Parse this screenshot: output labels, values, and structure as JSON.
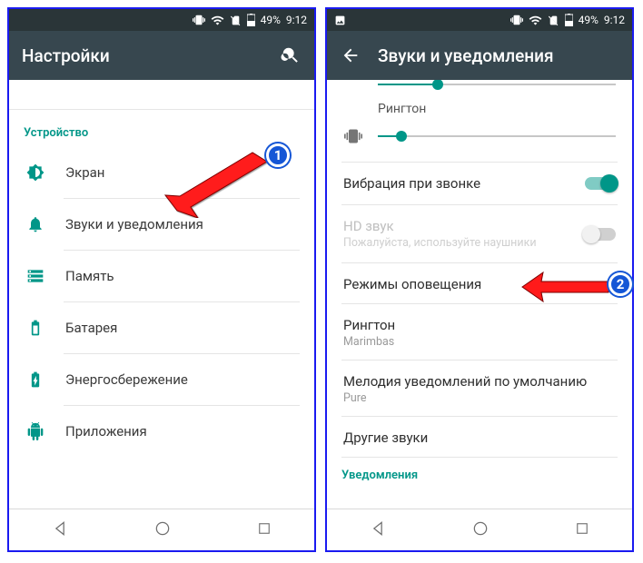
{
  "status": {
    "battery": "49%",
    "time": "9:12"
  },
  "left": {
    "title": "Настройки",
    "section": "Устройство",
    "items": [
      {
        "label": "Экран"
      },
      {
        "label": "Звуки и уведомления"
      },
      {
        "label": "Память"
      },
      {
        "label": "Батарея"
      },
      {
        "label": "Энергосбережение"
      },
      {
        "label": "Приложения"
      }
    ]
  },
  "right": {
    "title": "Звуки и уведомления",
    "ringtone_slider_label": "Рингтон",
    "rows": {
      "vibrate": "Вибрация при звонке",
      "hd_title": "HD звук",
      "hd_sub": "Пожалуйста, используйте наушники",
      "alert_modes": "Режимы оповещения",
      "ringtone_title": "Рингтон",
      "ringtone_value": "Marimbas",
      "notif_title": "Мелодия уведомлений по умолчанию",
      "notif_value": "Pure",
      "other": "Другие звуки",
      "section_notif": "Уведомления"
    },
    "sliders": {
      "top_pct": 25,
      "ringtone_pct": 10
    }
  },
  "badges": {
    "one": "1",
    "two": "2"
  }
}
